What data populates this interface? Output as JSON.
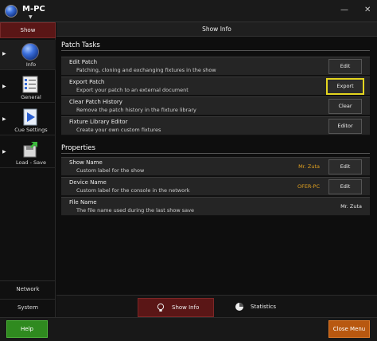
{
  "app": {
    "title": "M-PC",
    "logo_icon": "globe-icon"
  },
  "window_controls": {
    "minimize": "—",
    "close": "✕"
  },
  "sidebar": {
    "header": "Show",
    "items": [
      {
        "label": "Info",
        "icon": "globe-icon",
        "active": true
      },
      {
        "label": "General",
        "icon": "checklist-icon",
        "active": false
      },
      {
        "label": "Cue Settings",
        "icon": "play-document-icon",
        "active": false
      },
      {
        "label": "Load - Save",
        "icon": "floppy-load-save-icon",
        "active": false
      }
    ],
    "bottom": [
      "Network",
      "System"
    ]
  },
  "header": {
    "title": "Show Info"
  },
  "patch_tasks": {
    "title": "Patch Tasks",
    "rows": [
      {
        "title": "Edit Patch",
        "desc": "Patching, cloning and exchanging fixtures in the show",
        "button": "Edit"
      },
      {
        "title": "Export Patch",
        "desc": "Export your patch to an external document",
        "button": "Export"
      },
      {
        "title": "Clear Patch History",
        "desc": "Remove the patch history in the fixture library",
        "button": "Clear"
      },
      {
        "title": "Fixture Library Editor",
        "desc": "Create your own custom fixtures",
        "button": "Editor"
      }
    ]
  },
  "properties": {
    "title": "Properties",
    "rows": [
      {
        "title": "Show Name",
        "desc": "Custom label for the show",
        "value": "Mr. Zuta",
        "button": "Edit"
      },
      {
        "title": "Device Name",
        "desc": "Custom label for the console in the network",
        "value": "OFER-PC",
        "button": "Edit"
      },
      {
        "title": "File Name",
        "desc": "The file name used during the last show save",
        "value": "Mr. Zuta"
      }
    ]
  },
  "tabs": [
    {
      "label": "Show Info",
      "icon": "lightbulb-icon",
      "active": true
    },
    {
      "label": "Statistics",
      "icon": "pie-chart-icon",
      "active": false
    }
  ],
  "footer": {
    "help": "Help",
    "close": "Close Menu"
  },
  "colors": {
    "accent_red": "#5a1616",
    "highlight_yellow": "#e4d51f",
    "value_orange": "#e0a020",
    "help_green": "#2f8a1f",
    "close_orange": "#b85810"
  }
}
